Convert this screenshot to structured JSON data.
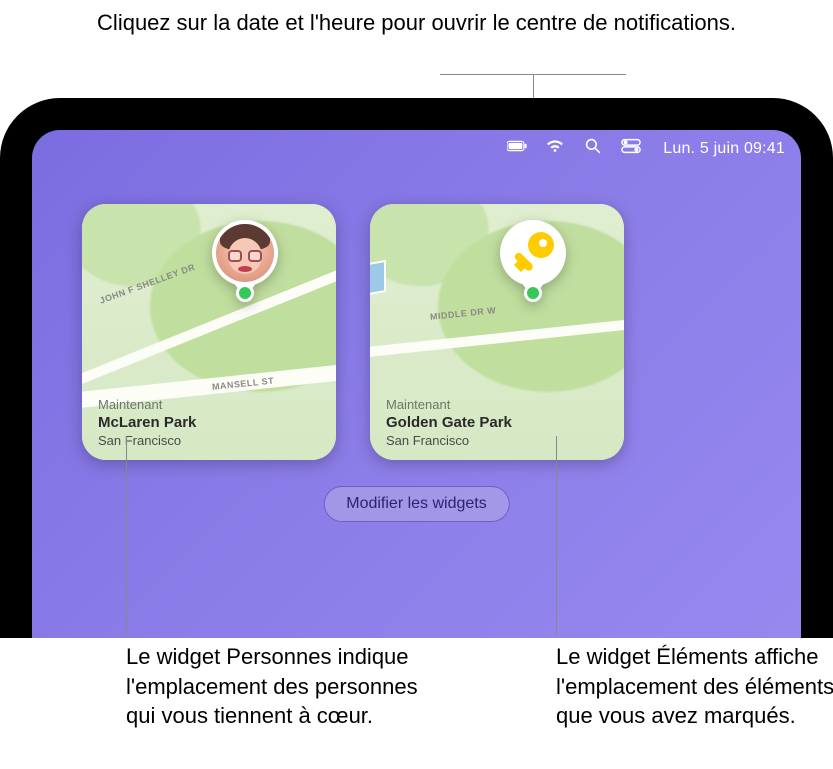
{
  "callouts": {
    "top": "Cliquez sur la date et l'heure pour ouvrir le centre de notifications.",
    "people": "Le widget Personnes indique l'emplacement des personnes qui vous tiennent à cœur.",
    "items": "Le widget Éléments affiche l'emplacement des éléments que vous avez marqués."
  },
  "menubar": {
    "datetime": "Lun. 5 juin  09:41"
  },
  "widgets": {
    "people": {
      "roads": [
        "JOHN F SHELLEY DR",
        "MANSELL ST"
      ],
      "time_label": "Maintenant",
      "place": "McLaren Park",
      "city": "San Francisco",
      "pin_icon": "memoji-avatar"
    },
    "items": {
      "roads": [
        "MIDDLE DR W"
      ],
      "time_label": "Maintenant",
      "place": "Golden Gate Park",
      "city": "San Francisco",
      "pin_icon": "key-icon"
    },
    "edit_label": "Modifier les widgets"
  }
}
